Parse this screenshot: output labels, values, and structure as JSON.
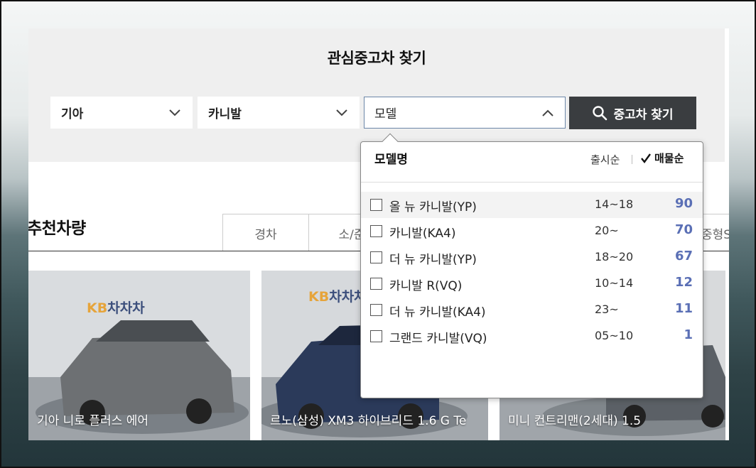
{
  "search": {
    "title": "관심중고차 찾기",
    "maker": "기아",
    "model_group": "카니발",
    "model_placeholder": "모델",
    "button_label": "중고차 찾기"
  },
  "dropdown": {
    "header": "모델명",
    "sort_release": "출시순",
    "sort_count": "매물순",
    "models": [
      {
        "name": "올 뉴 카니발(YP)",
        "years": "14~18",
        "count": "90"
      },
      {
        "name": "카니발(KA4)",
        "years": "20~",
        "count": "70"
      },
      {
        "name": "더 뉴 카니발(YP)",
        "years": "18~20",
        "count": "67"
      },
      {
        "name": "카니발 R(VQ)",
        "years": "10~14",
        "count": "12"
      },
      {
        "name": "더 뉴 카니발(KA4)",
        "years": "23~",
        "count": "11"
      },
      {
        "name": "그랜드 카니발(VQ)",
        "years": "05~10",
        "count": "1"
      }
    ]
  },
  "recommended": {
    "title": "추천차량",
    "tabs": [
      "경차",
      "소/준",
      "중형S"
    ],
    "cards": [
      {
        "caption": "기아 니로 플러스 에어",
        "logo_kb": "KB",
        "logo_text": "차차차"
      },
      {
        "caption": "르노(삼성) XM3 하이브리드 1.6 G Te",
        "logo_kb": "KB",
        "logo_text": "차차차"
      },
      {
        "caption": "미니 컨트리맨(2세대) 1.5"
      }
    ]
  },
  "colors": {
    "count_accent": "#5a6fb5",
    "button_bg": "#3a3d40",
    "panel_bg": "#efefef"
  }
}
